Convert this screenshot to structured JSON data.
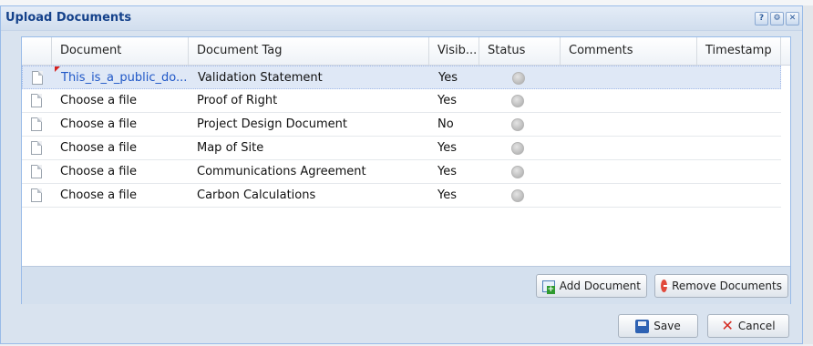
{
  "window": {
    "title": "Upload Documents",
    "tools": [
      "?",
      "⚙",
      "✕"
    ]
  },
  "grid": {
    "columns": [
      "Document",
      "Document Tag",
      "Visib...",
      "Status",
      "Comments",
      "Timestamp"
    ],
    "rows": [
      {
        "document": "This_is_a_public_do...",
        "tag": "Validation Statement",
        "visible": "Yes",
        "comments": "",
        "timestamp": ""
      },
      {
        "document": "Choose a file",
        "tag": "Proof of Right",
        "visible": "Yes",
        "comments": "",
        "timestamp": ""
      },
      {
        "document": "Choose a file",
        "tag": "Project Design Document",
        "visible": "No",
        "comments": "",
        "timestamp": ""
      },
      {
        "document": "Choose a file",
        "tag": "Map of Site",
        "visible": "Yes",
        "comments": "",
        "timestamp": ""
      },
      {
        "document": "Choose a file",
        "tag": "Communications Agreement",
        "visible": "Yes",
        "comments": "",
        "timestamp": ""
      },
      {
        "document": "Choose a file",
        "tag": "Carbon Calculations",
        "visible": "Yes",
        "comments": "",
        "timestamp": ""
      }
    ]
  },
  "footer": {
    "add_label": "Add Document",
    "remove_label": "Remove Documents"
  },
  "actions": {
    "save_label": "Save",
    "cancel_label": "Cancel"
  }
}
